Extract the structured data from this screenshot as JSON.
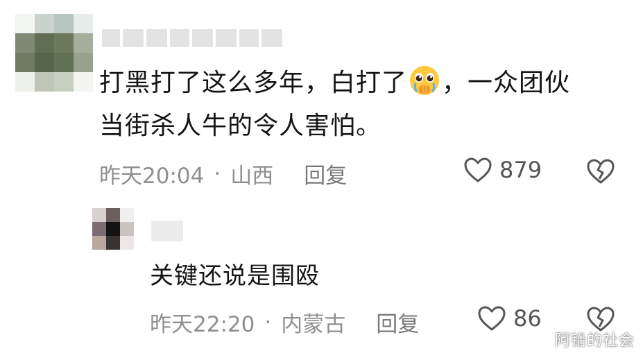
{
  "comments": [
    {
      "text_part1": "打黑打了这么多年，白打了",
      "emoji": "pleading-face-emoji",
      "text_part2": "，一众团伙",
      "text_line2": "当街杀人牛的令人害怕。",
      "time": "昨天20:04",
      "separator": "·",
      "location": "山西",
      "reply_label": "回复",
      "likes": "879",
      "replies": [
        {
          "text": "关键还说是围殴",
          "time": "昨天22:20",
          "separator": "·",
          "location": "内蒙古",
          "reply_label": "回复",
          "likes": "86"
        }
      ]
    }
  ],
  "watermark": "阿铅的社会",
  "colors": {
    "text": "#141414",
    "meta": "#8f8f8f",
    "icon": "#555555"
  }
}
